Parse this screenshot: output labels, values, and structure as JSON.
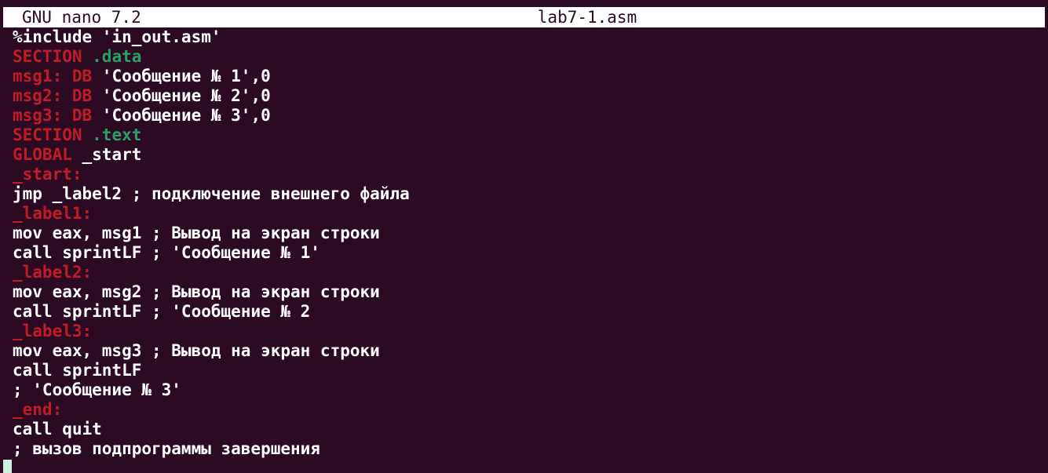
{
  "app": {
    "name": "GNU nano 7.2",
    "filename": "lab7-1.asm"
  },
  "colors": {
    "background": "#2c0a22",
    "default": "#ffffff",
    "keyword": "#c01c28",
    "section_name": "#26a269",
    "label": "#c01c28",
    "cursor": "#cfeedd"
  },
  "lines": [
    [
      {
        "t": "%include 'in_out.asm'",
        "c": "default"
      }
    ],
    [
      {
        "t": "SECTION",
        "c": "keyword"
      },
      {
        "t": " .data",
        "c": "section_name"
      }
    ],
    [
      {
        "t": "msg1:",
        "c": "label"
      },
      {
        "t": " DB",
        "c": "keyword"
      },
      {
        "t": " 'Сообщение № 1',0",
        "c": "default"
      }
    ],
    [
      {
        "t": "msg2:",
        "c": "label"
      },
      {
        "t": " DB",
        "c": "keyword"
      },
      {
        "t": " 'Сообщение № 2',0",
        "c": "default"
      }
    ],
    [
      {
        "t": "msg3:",
        "c": "label"
      },
      {
        "t": " DB",
        "c": "keyword"
      },
      {
        "t": " 'Сообщение № 3',0",
        "c": "default"
      }
    ],
    [
      {
        "t": "SECTION",
        "c": "keyword"
      },
      {
        "t": " .text",
        "c": "section_name"
      }
    ],
    [
      {
        "t": "GLOBAL",
        "c": "keyword"
      },
      {
        "t": " _start",
        "c": "default"
      }
    ],
    [
      {
        "t": "_start:",
        "c": "label"
      }
    ],
    [
      {
        "t": "jmp _label2 ; подключение внешнего файла",
        "c": "default"
      }
    ],
    [
      {
        "t": "_label1:",
        "c": "label"
      }
    ],
    [
      {
        "t": "mov eax, msg1 ; Вывод на экран строки",
        "c": "default"
      }
    ],
    [
      {
        "t": "call sprintLF ; 'Сообщение № 1'",
        "c": "default"
      }
    ],
    [
      {
        "t": "_label2:",
        "c": "label"
      }
    ],
    [
      {
        "t": "mov eax, msg2 ; Вывод на экран строки",
        "c": "default"
      }
    ],
    [
      {
        "t": "call sprintLF ; 'Сообщение № 2",
        "c": "default"
      }
    ],
    [
      {
        "t": "_label3:",
        "c": "label"
      }
    ],
    [
      {
        "t": "mov eax, msg3 ; Вывод на экран строки",
        "c": "default"
      }
    ],
    [
      {
        "t": "call sprintLF",
        "c": "default"
      }
    ],
    [
      {
        "t": "; 'Сообщение № 3'",
        "c": "default"
      }
    ],
    [
      {
        "t": "_end:",
        "c": "label"
      }
    ],
    [
      {
        "t": "call quit",
        "c": "default"
      }
    ],
    [
      {
        "t": "; вызов подпрограммы завершения",
        "c": "default"
      }
    ]
  ]
}
